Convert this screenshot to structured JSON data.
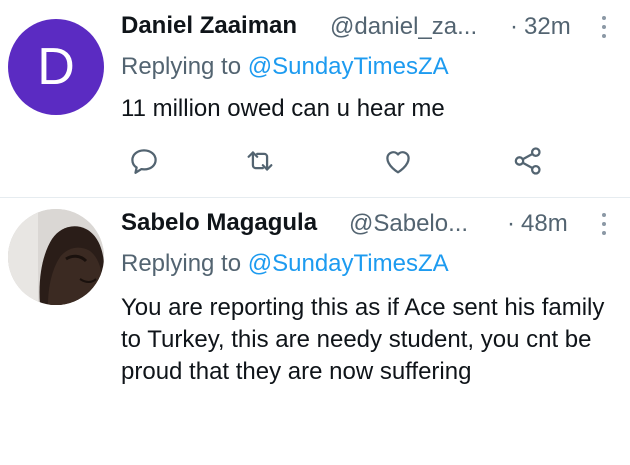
{
  "tweets": [
    {
      "avatar_letter": "D",
      "avatar_color": "#5b2bc2",
      "name": "Daniel Zaaiman",
      "handle": "@daniel_za...",
      "separator": "·",
      "time": "32m",
      "replying_prefix": "Replying to",
      "replying_to": "@SundayTimesZA",
      "text": "11 million owed can u hear me",
      "actions": [
        "reply-icon",
        "retweet-icon",
        "like-icon",
        "share-icon"
      ]
    },
    {
      "avatar_letter": "",
      "name": "Sabelo Magagula",
      "handle": "@Sabelo...",
      "separator": "·",
      "time": "48m",
      "replying_prefix": "Replying to",
      "replying_to": "@SundayTimesZA",
      "text": "You are reporting this as if Ace sent his family to Turkey, this are needy student, you cnt be proud that they are now suffering"
    }
  ],
  "colors": {
    "link": "#1d9bf0",
    "secondary_text": "#536471",
    "divider": "#e6ecf0"
  }
}
